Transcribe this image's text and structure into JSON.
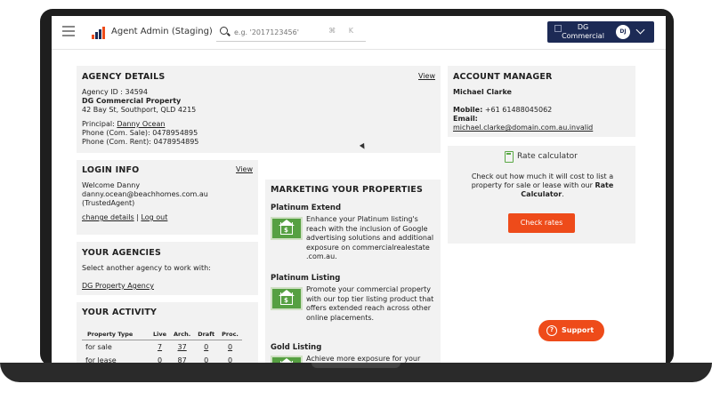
{
  "header": {
    "app_title": "Agent Admin (Staging)",
    "search_placeholder": "e.g. '2017123456'",
    "search_shortcut": "⌘ K",
    "agency_logo_alt": "DG Commercial",
    "avatar_initials": "DJ"
  },
  "agency_details": {
    "title": "AGENCY DETAILS",
    "view_label": "View",
    "agency_id": "Agency ID : 34594",
    "name": "DG Commercial Property",
    "address": "42 Bay St, Southport, QLD 4215",
    "principal_label": "Principal:",
    "principal_name": "Danny Ocean",
    "phone_sale": "Phone (Com. Sale): 0478954895",
    "phone_rent": "Phone (Com. Rent): 0478954895"
  },
  "account_manager": {
    "title": "ACCOUNT MANAGER",
    "name": "Michael Clarke",
    "mobile_label": "Mobile:",
    "mobile": "+61 61488045062",
    "email_label": "Email:",
    "email": "michael.clarke@domain.com.au.invalid"
  },
  "login_info": {
    "title": "LOGIN INFO",
    "view_label": "View",
    "welcome": "Welcome Danny",
    "email": "danny.ocean@beachhomes.com.au",
    "role": "(TrustedAgent)",
    "change_details": "change details",
    "separator": "|",
    "logout": "Log out"
  },
  "your_agencies": {
    "title": "YOUR AGENCIES",
    "prompt": "Select another agency to work with:",
    "agency_link": "DG Property Agency"
  },
  "your_activity": {
    "title": "YOUR ACTIVITY",
    "columns": [
      "Property Type",
      "Live",
      "Arch.",
      "Draft",
      "Proc."
    ],
    "rows": [
      {
        "type": "for sale",
        "live": "7",
        "arch": "37",
        "draft": "0",
        "proc": "0"
      },
      {
        "type": "for lease",
        "live": "0",
        "arch": "87",
        "draft": "0",
        "proc": "0"
      }
    ]
  },
  "marketing": {
    "title": "MARKETING YOUR PROPERTIES",
    "items": [
      {
        "title": "Platinum Extend",
        "desc": "Enhance your Platinum listing's reach with the inclusion of Google advertising solutions and additional exposure on commercialrealestate .com.au."
      },
      {
        "title": "Platinum Listing",
        "desc": "Promote your commercial property with our top tier listing product that offers extended reach across other online placements."
      },
      {
        "title": "Gold Listing",
        "desc": "Achieve more exposure for your"
      }
    ]
  },
  "rate_calculator": {
    "title": "Rate calculator",
    "desc_pre": "Check out how much it will cost to list a property for sale or lease with our ",
    "desc_bold": "Rate Calculator",
    "desc_post": ".",
    "button": "Check rates"
  },
  "support": {
    "label": "Support",
    "icon_glyph": "?"
  },
  "colors": {
    "accent": "#ee4b1a",
    "navy": "#1c2a55",
    "green": "#56a042"
  }
}
